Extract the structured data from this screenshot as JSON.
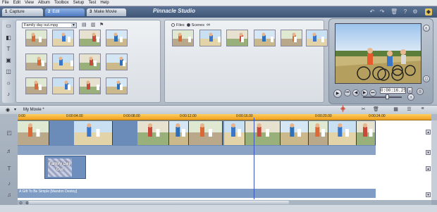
{
  "menu": [
    "File",
    "Edit",
    "View",
    "Album",
    "Toolbox",
    "Setup",
    "Test",
    "Help"
  ],
  "tabs": [
    {
      "num": "1",
      "label": "Capture"
    },
    {
      "num": "2",
      "label": "Edit"
    },
    {
      "num": "3",
      "label": "Make Movie"
    }
  ],
  "app_title": "Pinnacle Studio",
  "album": {
    "selected": "Family day out.mpg",
    "view_files": "Files",
    "view_scenes": "Scenes"
  },
  "player": {
    "timecode": "0:00:16.25"
  },
  "timeline": {
    "movie_title": "My Movie *",
    "ruler": [
      "0:00:04.00",
      "0:00:08.00",
      "0:00:12.00",
      "0:00:16.00",
      "0:00:20.00",
      "0:00:24.00"
    ],
    "ruler_start": "0:00",
    "title_clip": "Family Day Out",
    "music_clip": "A Gift To Be Simple [Mandon Destey]"
  },
  "colors": {
    "accent": "#f0a020",
    "tab_active": "#4f7bc2",
    "track_clip": "#6b8bb8"
  }
}
